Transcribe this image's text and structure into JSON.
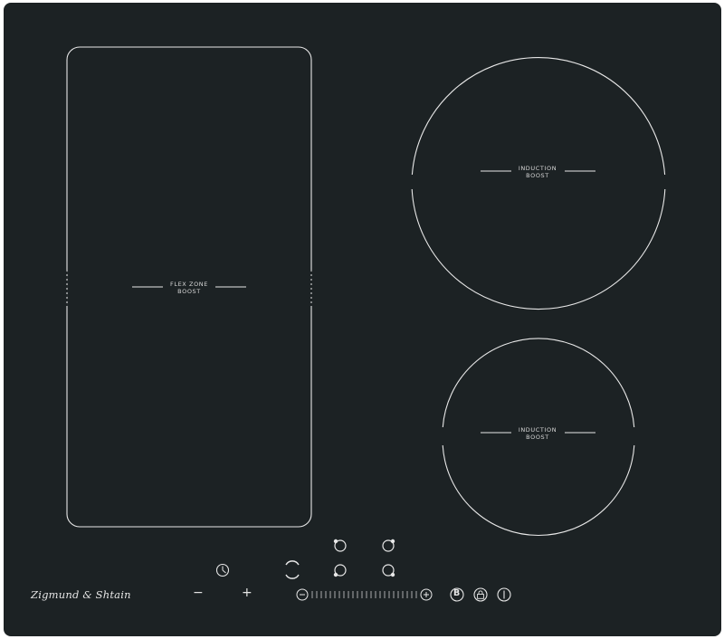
{
  "brand": {
    "name": "Zigmund & Shtain"
  },
  "zones": {
    "flex": {
      "line1": "FLEX ZONE",
      "line2": "BOOST"
    },
    "top_right": {
      "line1": "INDUCTION",
      "line2": "BOOST"
    },
    "bottom_right": {
      "line1": "INDUCTION",
      "line2": "BOOST"
    }
  },
  "controls": {
    "minus_symbol": "−",
    "plus_symbol": "+",
    "boost_symbol": "B"
  },
  "colors": {
    "glass": "#1c2224",
    "line": "#e8e8e8",
    "text": "#d8d8d8"
  },
  "icons": [
    "timer-icon",
    "power-icon",
    "lock-icon",
    "info-icon",
    "zone-selector-icon"
  ]
}
